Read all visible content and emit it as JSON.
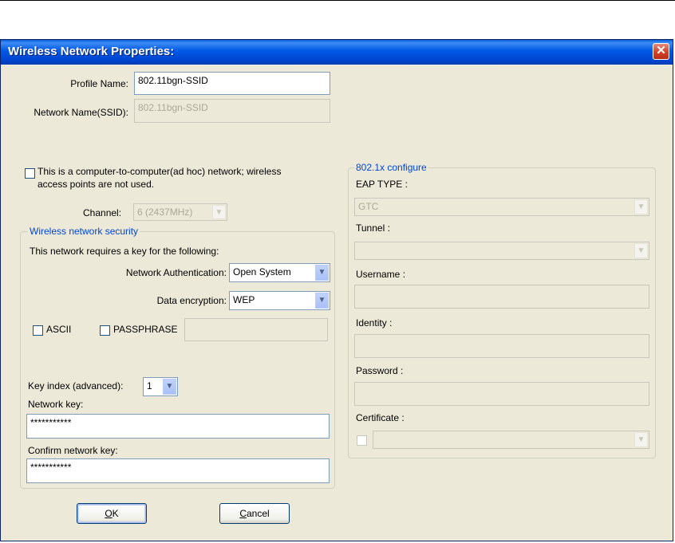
{
  "window": {
    "title": "Wireless Network Properties:",
    "close_glyph": "✕"
  },
  "profile": {
    "label": "Profile Name:",
    "value": "802.11bgn-SSID"
  },
  "ssid": {
    "label": "Network Name(SSID):",
    "value": "802.11bgn-SSID"
  },
  "adhoc": {
    "line1": "This is a computer-to-computer(ad hoc) network; wireless",
    "line2": "access points are not used.",
    "checked": false
  },
  "channel": {
    "label": "Channel:",
    "value": "6  (2437MHz)"
  },
  "security": {
    "group_title": "Wireless network security",
    "intro": "This network requires a key for the following:",
    "auth_label": "Network Authentication:",
    "auth_value": "Open System",
    "enc_label": "Data encryption:",
    "enc_value": "WEP",
    "ascii_label": "ASCII",
    "passphrase_label": "PASSPHRASE",
    "passphrase_value": "",
    "key_index_label": "Key index (advanced):",
    "key_index_value": "1",
    "network_key_label": "Network key:",
    "network_key_value": "***********",
    "confirm_key_label": "Confirm network key:",
    "confirm_key_value": "***********"
  },
  "dot1x": {
    "group_title": "802.1x configure",
    "eap_label": "EAP TYPE :",
    "eap_value": "GTC",
    "tunnel_label": "Tunnel :",
    "tunnel_value": "",
    "username_label": "Username :",
    "username_value": "",
    "identity_label": "Identity :",
    "identity_value": "",
    "password_label": "Password :",
    "password_value": "",
    "certificate_label": "Certificate :",
    "certificate_value": ""
  },
  "buttons": {
    "ok_mnemonic": "O",
    "ok_rest": "K",
    "cancel_mnemonic": "C",
    "cancel_rest": "ancel"
  },
  "icons": {
    "dropdown_arrow": "chevron-down-icon",
    "close": "close-icon"
  },
  "colors": {
    "titlebar": "#0058E5",
    "dialog_bg": "#ECE9D8",
    "group_title": "#0046D5",
    "close_button": "#D24128"
  }
}
